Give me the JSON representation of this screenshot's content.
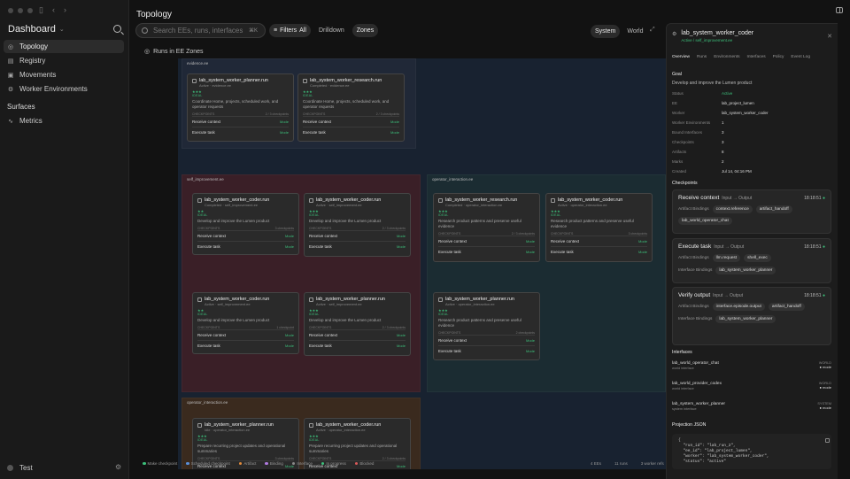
{
  "sidebar": {
    "brand": "Dashboard",
    "items": [
      {
        "label": "Topology",
        "icon": "topology-icon",
        "active": true
      },
      {
        "label": "Registry",
        "icon": "registry-icon"
      },
      {
        "label": "Movements",
        "icon": "movements-icon"
      },
      {
        "label": "Worker Environments",
        "icon": "worker-env-icon"
      }
    ],
    "section": "Surfaces",
    "section_items": [
      {
        "label": "Metrics",
        "icon": "metrics-icon"
      }
    ],
    "user": "Test"
  },
  "header": {
    "title": "Topology",
    "search_placeholder": "Search EEs, runs, interfaces...",
    "search_kbd": "⌘K",
    "filters": "Filters",
    "filters_value": "All",
    "drilldown": "Drilldown",
    "zones": "Zones",
    "system": "System",
    "world": "World"
  },
  "canvas": {
    "label": "Runs in EE Zones",
    "zones": [
      {
        "name": "evidence.ee"
      },
      {
        "name": "self_improvement.ee"
      },
      {
        "name": "operator_interaction.ee"
      },
      {
        "name": "operator_interaction.ee"
      }
    ],
    "cards": [
      {
        "name": "lab_system_worker_planner.run",
        "sub": "Active · evidence.ee",
        "state": "IDEAL",
        "desc": "Coordinate Home, projects, scheduled work, and operator requests",
        "cp": "CHECKPOINTS",
        "cpv": "2 / 3 checkpoints",
        "ck1": "Receive context",
        "ck2": "Execute task",
        "mode": "Mode"
      },
      {
        "name": "lab_system_worker_research.run",
        "sub": "Completed · evidence.ee",
        "state": "IDEAL",
        "desc": "Coordinate Home, projects, scheduled work, and operator requests",
        "cp": "CHECKPOINTS",
        "cpv": "2 / 3 checkpoints",
        "ck1": "Receive context",
        "ck2": "Execute task",
        "mode": "Mode"
      },
      {
        "name": "lab_system_worker_coder.run",
        "sub": "Completed · self_improvement.ee",
        "state": "IDEAL",
        "desc": "Develop and improve the Lumen product",
        "cp": "CHECKPOINTS",
        "cpv": "3 checkpoints",
        "ck1": "Receive context",
        "ck2": "Execute task",
        "mode": "Mode"
      },
      {
        "name": "lab_system_worker_coder.run",
        "sub": "Active · self_improvement.ee",
        "state": "IDEAL",
        "desc": "Develop and improve the Lumen product",
        "cp": "CHECKPOINTS",
        "cpv": "2 / 3 checkpoints",
        "ck1": "Receive context",
        "ck2": "Execute task",
        "mode": "Mode"
      },
      {
        "name": "lab_system_worker_research.run",
        "sub": "Completed · operator_interaction.ee",
        "state": "IDEAL",
        "desc": "Research product patterns and preserve useful evidence",
        "cp": "CHECKPOINTS",
        "cpv": "2 / 3 checkpoints",
        "ck1": "Receive context",
        "ck2": "Execute task",
        "mode": "Mode"
      },
      {
        "name": "lab_system_worker_coder.run",
        "sub": "Active · operator_interaction.ee",
        "state": "IDEAL",
        "desc": "Research product patterns and preserve useful evidence",
        "cp": "CHECKPOINTS",
        "cpv": "3 checkpoints",
        "ck1": "Receive context",
        "ck2": "Execute task",
        "mode": "Mode"
      },
      {
        "name": "lab_system_worker_coder.run",
        "sub": "Active · self_improvement.ee",
        "state": "IDEAL",
        "desc": "Develop and improve the Lumen product",
        "cp": "CHECKPOINTS",
        "cpv": "1 checkpoint",
        "ck1": "Receive context",
        "ck2": "Execute task",
        "mode": "Mode"
      },
      {
        "name": "lab_system_worker_planner.run",
        "sub": "Active · self_improvement.ee",
        "state": "IDEAL",
        "desc": "Develop and improve the Lumen product",
        "cp": "CHECKPOINTS",
        "cpv": "2 / 3 checkpoints",
        "ck1": "Receive context",
        "ck2": "Execute task",
        "mode": "Mode"
      },
      {
        "name": "lab_system_worker_planner.run",
        "sub": "Active · operator_interaction.ee",
        "state": "IDEAL",
        "desc": "Research product patterns and preserve useful evidence",
        "cp": "CHECKPOINTS",
        "cpv": "2 checkpoints",
        "ck1": "Receive context",
        "ck2": "Execute task",
        "mode": "Mode"
      },
      {
        "name": "lab_system_worker_planner.run",
        "sub": "Idle · operator_interaction.ee",
        "state": "IDEAL",
        "desc": "Prepare recurring project updates and operational summaries",
        "cp": "CHECKPOINTS",
        "cpv": "3 checkpoints",
        "ck1": "Receive context",
        "ck2": "Execute task",
        "mode": "Mode"
      },
      {
        "name": "lab_system_worker_coder.run",
        "sub": "Active · operator_interaction.ee",
        "state": "IDEAL",
        "desc": "Prepare recurring project updates and operational summaries",
        "cp": "CHECKPOINTS",
        "cpv": "2 / 3 checkpoints",
        "ck1": "Receive context",
        "ck2": "Execute task",
        "mode": "Mode"
      }
    ],
    "legend": [
      {
        "label": "Make checkpoint",
        "color": "#3cbf7a"
      },
      {
        "label": "Scheduled checkpoint",
        "color": "#5a8fd8"
      },
      {
        "label": "Artifact",
        "color": "#e08a3c"
      },
      {
        "label": "Binding",
        "color": "#b07be0"
      },
      {
        "label": "Interface",
        "color": "#8a8a8a"
      },
      {
        "label": "In progress",
        "color": "#3cbf7a"
      },
      {
        "label": "Blocked",
        "color": "#d85a5a"
      }
    ],
    "stats": [
      "4 EEs",
      "11 runs",
      "3 worker refs"
    ]
  },
  "panel": {
    "title": "lab_system_worker_coder",
    "subtitle": "Active / self_improvement.ee",
    "tabs": [
      "Overview",
      "Runs",
      "Environments",
      "Interfaces",
      "Policy",
      "Event Log"
    ],
    "goal_label": "Goal",
    "goal": "Develop and improve the Lumen product",
    "props": [
      {
        "k": "Status",
        "v": "Active"
      },
      {
        "k": "EE",
        "v": "lab_project_lumen"
      },
      {
        "k": "Worker",
        "v": "lab_system_worker_coder"
      },
      {
        "k": "Worker Environments",
        "v": "1"
      },
      {
        "k": "Bound Interfaces",
        "v": "3"
      },
      {
        "k": "Checkpoints",
        "v": "3"
      },
      {
        "k": "Artifacts",
        "v": "8"
      },
      {
        "k": "Marks",
        "v": "2"
      },
      {
        "k": "Created",
        "v": "Jul 14, 04:16 PM"
      }
    ],
    "checkpoints_label": "Checkpoints",
    "checkpoints": [
      {
        "name": "Receive context",
        "io": "Input → Output",
        "time": "18:18:51",
        "artifact_label": "Artifact Bindings",
        "artifacts": [
          "context.reference",
          "artifact_handoff",
          "lab_world_operator_chat"
        ],
        "iface_label": "",
        "ifaces": []
      },
      {
        "name": "Execute task",
        "io": "Input → Output",
        "time": "18:18:51",
        "artifact_label": "Artifact Bindings",
        "artifacts": [
          "llm.request",
          "shell_exec"
        ],
        "iface_label": "Interface Bindings",
        "ifaces": [
          "lab_system_worker_planner"
        ]
      },
      {
        "name": "Verify output",
        "io": "Input → Output",
        "time": "18:18:51",
        "artifact_label": "Artifact Bindings",
        "artifacts": [
          "interface.episode.output",
          "artifact_handoff"
        ],
        "iface_label": "Interface Bindings",
        "ifaces": [
          "lab_system_worker_planner"
        ]
      }
    ],
    "interfaces_label": "Interfaces",
    "interfaces": [
      {
        "name": "lab_world_operator_chat",
        "sub": "world interface",
        "type": "WORLD",
        "mode": "● mode"
      },
      {
        "name": "lab_world_provider_codex",
        "sub": "world interface",
        "type": "WORLD",
        "mode": "● mode"
      },
      {
        "name": "lab_system_worker_planner",
        "sub": "system interface",
        "type": "SYSTEM",
        "mode": "● mode"
      }
    ],
    "json_label": "Projection JSON",
    "json": "{\n  \"run_id\": \"lab_run_2\",\n  \"ee_id\": \"lab_project_lumen\",\n  \"worker\": \"lab_system_worker_coder\",\n  \"status\": \"active\""
  }
}
